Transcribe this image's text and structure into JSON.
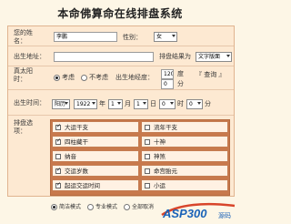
{
  "page_title": "本命佛算命在线排盘系统",
  "labels": {
    "name": "您的姓名：",
    "gender": "性别：",
    "birthplace": "出生地址：",
    "display": "排盘结果为",
    "true_solar": "真太阳时：",
    "longitude": "出生地经度：",
    "birthtime": "出生时间：",
    "options": "排盘选项："
  },
  "fields": {
    "name_value": "李鹏",
    "gender_value": "女",
    "display_value": "文字版面",
    "longitude_value": "120",
    "longitude_unit": "度",
    "lookup_link": "『 查询 』",
    "zero": "0",
    "fen": "分"
  },
  "true_solar": {
    "opt1": "考虑",
    "opt2": "不考虑"
  },
  "datetime": {
    "calendar": "阳历",
    "year": "1922",
    "year_unit": "年",
    "month": "1",
    "month_unit": "月",
    "day": "1",
    "day_unit": "日",
    "hour": "0",
    "hour_unit": "时",
    "minute": "0",
    "minute_unit": "分"
  },
  "options": [
    {
      "label": "大运干支",
      "checked": true
    },
    {
      "label": "流年干支",
      "checked": false
    },
    {
      "label": "四柱藏干",
      "checked": true
    },
    {
      "label": "十神",
      "checked": false
    },
    {
      "label": "纳音",
      "checked": false
    },
    {
      "label": "神煞",
      "checked": false
    },
    {
      "label": "交运岁数",
      "checked": true
    },
    {
      "label": "命宫胎元",
      "checked": false
    },
    {
      "label": "起运交运时间",
      "checked": true
    },
    {
      "label": "小运",
      "checked": false
    }
  ],
  "modes": [
    "简洁模式",
    "专业模式",
    "全部取消"
  ],
  "watermark": {
    "brand": "ASP300",
    "suffix": "源码"
  },
  "colors": {
    "accent": "#c8794c",
    "panel": "#fde9d2",
    "logo": "#1a63b8"
  }
}
